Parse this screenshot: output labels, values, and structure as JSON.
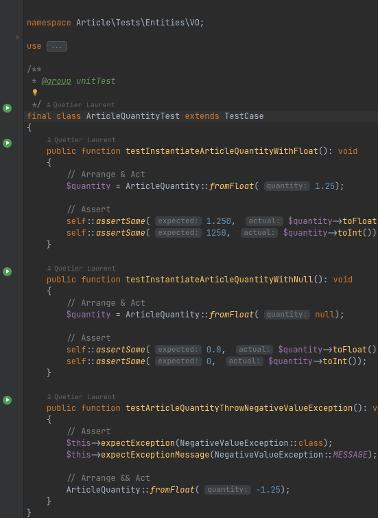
{
  "namespace": {
    "kw": "namespace",
    "path": "Article\\Tests\\Entities\\VO",
    "semi": ";"
  },
  "use": {
    "kw": "use",
    "ellipsis": "..."
  },
  "docblock": {
    "open": "/**",
    "line1_star": " *",
    "tag": "@group",
    "tag_text": " unitTest",
    "close": " */"
  },
  "author": "Quétier Laurent",
  "class_decl": {
    "final": "final",
    "class": "class",
    "name": "ArticleQuantityTest",
    "extends": "extends",
    "base": "TestCase"
  },
  "brace_open": "{",
  "brace_close": "}",
  "m1": {
    "name": "testInstantiateArticleQuantityWithFloat",
    "ret": "void",
    "c_arrange_act": "// Arrange & Act",
    "q_assign": {
      "var": "$quantity",
      "eq": " = ",
      "cls": "ArticleQuantity",
      "dbl": "::",
      "call": "fromFloat",
      "hint": "quantity:",
      "val": "1.25"
    },
    "c_assert": "// Assert",
    "a1": {
      "self": "self",
      "call": "assertSame",
      "h1": "expected:",
      "v1": "1.250",
      "h2": "actual:",
      "var": "$quantity",
      "m": "toFloat"
    },
    "a2": {
      "self": "self",
      "call": "assertSame",
      "h1": "expected:",
      "v1": "1250",
      "h2": "actual:",
      "var": "$quantity",
      "m": "toInt"
    }
  },
  "m2": {
    "name": "testInstantiateArticleQuantityWithNull",
    "ret": "void",
    "c_arrange_act": "// Arrange & Act",
    "q_assign": {
      "var": "$quantity",
      "eq": " = ",
      "cls": "ArticleQuantity",
      "dbl": "::",
      "call": "fromFloat",
      "hint": "quantity:",
      "val": "null"
    },
    "c_assert": "// Assert",
    "a1": {
      "self": "self",
      "call": "assertSame",
      "h1": "expected:",
      "v1": "0.0",
      "h2": "actual:",
      "var": "$quantity",
      "m": "toFloat"
    },
    "a2": {
      "self": "self",
      "call": "assertSame",
      "h1": "expected:",
      "v1": "0",
      "h2": "actual:",
      "var": "$quantity",
      "m": "toInt"
    }
  },
  "m3": {
    "name": "testArticleQuantityThrowNegativeValueException",
    "ret": "void",
    "c_assert": "// Assert",
    "e1": {
      "this": "$this",
      "call": "expectException",
      "arg_cls": "NegativeValueException",
      "dbl": "::",
      "kw": "class"
    },
    "e2": {
      "this": "$this",
      "call": "expectExceptionMessage",
      "arg_cls": "NegativeValueException",
      "dbl": "::",
      "const": "MESSAGE"
    },
    "c_arrange_act": "// Arrange && Act",
    "stmt": {
      "cls": "ArticleQuantity",
      "dbl": "::",
      "call": "fromFloat",
      "hint": "quantity:",
      "val": "-1.25"
    }
  },
  "pub_fn": {
    "public": "public",
    "function": "function"
  },
  "sym": {
    "lp": "(",
    "rp": ")",
    "colon": ":",
    "semi": ";",
    "comma": ",",
    "arrow": "->"
  }
}
